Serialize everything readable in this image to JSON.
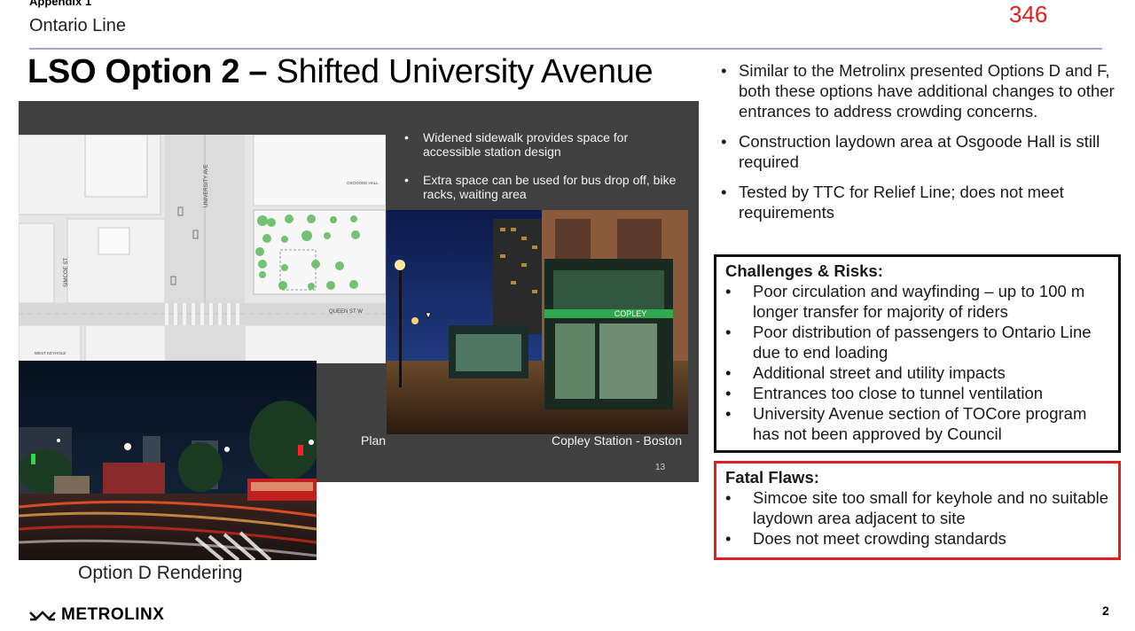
{
  "header": {
    "appendix": "Appendix 1",
    "subtitle": "Ontario Line",
    "page_number_top": "346"
  },
  "title": {
    "bold": "LSO Option 2 –",
    "regular": "Shifted University Avenue"
  },
  "slide": {
    "bullets": [
      "Widened sidewalk provides space for accessible station design",
      "Extra space can be used for bus drop off, bike racks, waiting area"
    ],
    "plan_labels": {
      "university_ave": "UNIVERSITY AVE",
      "simcoe_st": "SIMCOE ST",
      "queen_st": "QUEEN ST W",
      "osgoode_hall": "OSGOODE HALL",
      "west_keyhole": "WEST KEYHOLE"
    },
    "plan_caption": "Plan",
    "photo_caption": "Copley Station - Boston",
    "station_sign": "COPLEY",
    "slide_number": "13"
  },
  "rendering_caption": "Option D Rendering",
  "bullets": [
    "Similar to the Metrolinx presented Options D and F, both these options have additional changes to other entrances to address crowding concerns.",
    "Construction laydown area at Osgoode Hall is still required",
    "Tested by TTC for Relief Line; does not meet requirements"
  ],
  "challenges": {
    "heading": "Challenges & Risks:",
    "items": [
      "Poor circulation and wayfinding – up to 100 m longer transfer for majority of riders",
      "Poor distribution of passengers to Ontario Line due to end loading",
      "Additional street and utility impacts",
      "Entrances too close to tunnel ventilation",
      "University Avenue section of TOCore program has not been approved by Council"
    ]
  },
  "fatal_flaws": {
    "heading": "Fatal Flaws:",
    "items": [
      "Simcoe site too small for keyhole and no suitable laydown area adjacent to site",
      "Does not meet crowding standards"
    ]
  },
  "footer": {
    "logo_text": "METROLINX",
    "page_number": "2"
  },
  "colors": {
    "accent_rule": "#b79cc4",
    "page_number_red": "#e0201a",
    "fatal_border": "#e51d1d",
    "slide_bg": "#404040",
    "tree_green": "#5cb85c"
  }
}
